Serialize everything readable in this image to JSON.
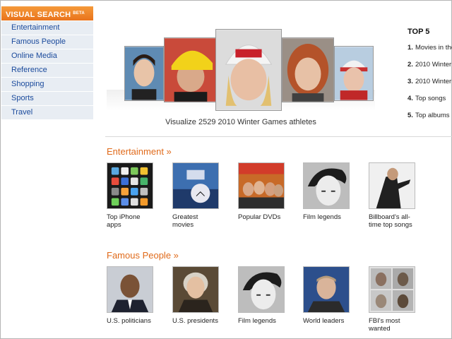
{
  "sidebar": {
    "title": "VISUAL SEARCH",
    "badge": "BETA",
    "items": [
      {
        "label": "Entertainment"
      },
      {
        "label": "Famous People"
      },
      {
        "label": "Online Media"
      },
      {
        "label": "Reference"
      },
      {
        "label": "Shopping"
      },
      {
        "label": "Sports"
      },
      {
        "label": "Travel"
      }
    ]
  },
  "featured": {
    "caption": "Visualize 2529 2010 Winter Games athletes"
  },
  "top5": {
    "title": "TOP 5",
    "items": [
      {
        "num": "1.",
        "label": "Movies in the"
      },
      {
        "num": "2.",
        "label": "2010 Winter"
      },
      {
        "num": "3.",
        "label": "2010 Winter"
      },
      {
        "num": "4.",
        "label": "Top songs"
      },
      {
        "num": "5.",
        "label": "Top albums"
      }
    ]
  },
  "sections": [
    {
      "title": "Entertainment »",
      "tiles": [
        {
          "label": "Top iPhone apps"
        },
        {
          "label": "Greatest movies"
        },
        {
          "label": "Popular DVDs"
        },
        {
          "label": "Film legends"
        },
        {
          "label": "Billboard's all-time top songs"
        }
      ]
    },
    {
      "title": "Famous People »",
      "tiles": [
        {
          "label": "U.S. politicians"
        },
        {
          "label": "U.S. presidents"
        },
        {
          "label": "Film legends"
        },
        {
          "label": "World leaders"
        },
        {
          "label": "FBI's most wanted"
        }
      ]
    }
  ],
  "colors": {
    "accent_orange": "#e06a1a",
    "sidebar_header": "#ee7f26",
    "sidebar_item_bg": "#e8edf3",
    "link_blue": "#1a4a9c"
  }
}
